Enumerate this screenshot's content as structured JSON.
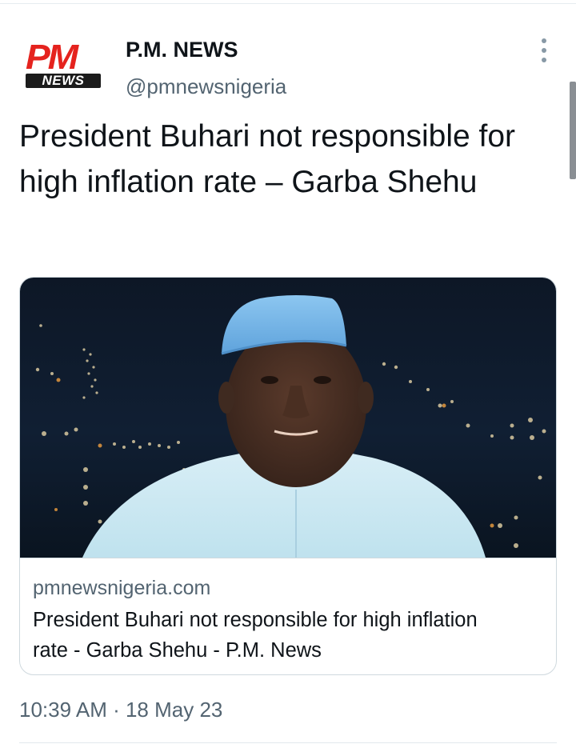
{
  "author": {
    "logo_pm": "PM",
    "logo_news": "NEWS",
    "display_name": "P.M. NEWS",
    "handle": "@pmnewsnigeria"
  },
  "tweet": {
    "text": "President Buhari not responsible for high inflation rate – Garba Shehu",
    "timestamp": "10:39 AM · 18 May 23"
  },
  "link_card": {
    "domain": "pmnewsnigeria.com",
    "title": "President Buhari not responsible for high inflation rate - Garba Shehu - P.M. News"
  },
  "icons": {
    "more": "more-vertical-icon"
  },
  "colors": {
    "brand_red": "#e5231e",
    "secondary_text": "#536471",
    "cap_blue": "#7ab6e6"
  }
}
